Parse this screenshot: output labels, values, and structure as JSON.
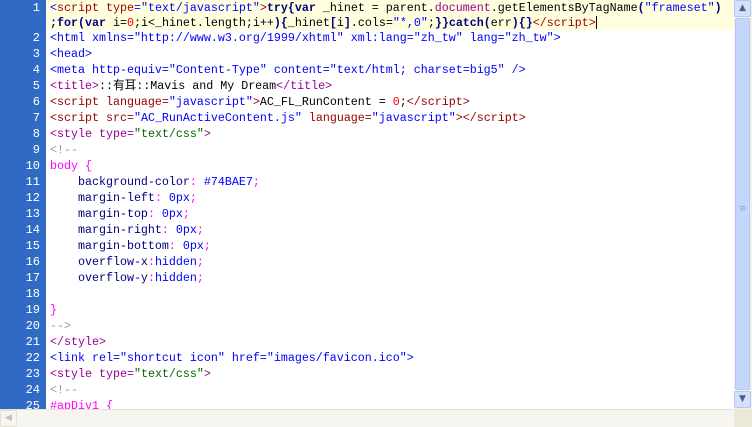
{
  "editor": {
    "lines": [
      {
        "num": "1",
        "rows": [
          [
            [
              "t",
              "<"
            ],
            [
              "s",
              "script "
            ],
            [
              "s",
              "type"
            ],
            [
              "t",
              "=\"text/javascript\""
            ],
            [
              "s",
              ">"
            ],
            [
              "b",
              "try{var"
            ],
            [
              "x",
              " _hinet = parent."
            ],
            [
              "d",
              "document"
            ],
            [
              "x",
              ".getElementsByTagName"
            ],
            [
              "b",
              "("
            ],
            [
              "t",
              "\"frameset\""
            ],
            [
              "b",
              ")"
            ]
          ],
          [
            [
              "b",
              ";for(var"
            ],
            [
              "x",
              " i="
            ],
            [
              "n",
              "0"
            ],
            [
              "x",
              ";i<_hinet.length;i++"
            ],
            [
              "b",
              ")"
            ],
            [
              "b",
              "{"
            ],
            [
              "x",
              "_hinet"
            ],
            [
              "b",
              "["
            ],
            [
              "x",
              "i"
            ],
            [
              "b",
              "]"
            ],
            [
              "x",
              ".cols="
            ],
            [
              "t",
              "\"*,0\""
            ],
            [
              "x",
              ";"
            ],
            [
              "b",
              "}}catch("
            ],
            [
              "x",
              "err"
            ],
            [
              "b",
              "){}"
            ],
            [
              "s",
              "</script>"
            ]
          ]
        ]
      },
      {
        "num": "2",
        "rows": [
          [
            [
              "t",
              "<html xmlns=\"http://www.w3.org/1999/xhtml\" xml:lang=\"zh_tw\" lang=\"zh_tw\">"
            ]
          ]
        ]
      },
      {
        "num": "3",
        "rows": [
          [
            [
              "t",
              "<head>"
            ]
          ]
        ]
      },
      {
        "num": "4",
        "rows": [
          [
            [
              "t",
              "<meta http-equiv=\"Content-Type\" content=\"text/html; charset=big5\" />"
            ]
          ]
        ]
      },
      {
        "num": "5",
        "rows": [
          [
            [
              "st",
              "<title>"
            ],
            [
              "x",
              "::有耳::Mavis and My Dream"
            ],
            [
              "st",
              "</title>"
            ]
          ]
        ]
      },
      {
        "num": "6",
        "rows": [
          [
            [
              "s",
              "<script language="
            ],
            [
              "t",
              "\"javascript\""
            ],
            [
              "s",
              ">"
            ],
            [
              "x",
              "AC_FL_RunContent = "
            ],
            [
              "n",
              "0"
            ],
            [
              "x",
              ";"
            ],
            [
              "s",
              "</script>"
            ]
          ]
        ]
      },
      {
        "num": "7",
        "rows": [
          [
            [
              "s",
              "<script src="
            ],
            [
              "t",
              "\"AC_RunActiveContent.js\""
            ],
            [
              "s",
              " language="
            ],
            [
              "t",
              "\"javascript\""
            ],
            [
              "s",
              "></script>"
            ]
          ]
        ]
      },
      {
        "num": "8",
        "rows": [
          [
            [
              "st",
              "<style type="
            ],
            [
              "g",
              "\"text/css\""
            ],
            [
              "st",
              ">"
            ]
          ]
        ]
      },
      {
        "num": "9",
        "rows": [
          [
            [
              "c",
              "<!--"
            ]
          ]
        ]
      },
      {
        "num": "10",
        "rows": [
          [
            [
              "m",
              "body {"
            ]
          ]
        ]
      },
      {
        "num": "11",
        "rows": [
          [
            [
              "p",
              "    background-color"
            ],
            [
              "m",
              ":"
            ],
            [
              "v",
              " #74BAE7"
            ],
            [
              "m",
              ";"
            ]
          ]
        ]
      },
      {
        "num": "12",
        "rows": [
          [
            [
              "p",
              "    margin-left"
            ],
            [
              "m",
              ":"
            ],
            [
              "v",
              " 0px"
            ],
            [
              "m",
              ";"
            ]
          ]
        ]
      },
      {
        "num": "13",
        "rows": [
          [
            [
              "p",
              "    margin-top"
            ],
            [
              "m",
              ":"
            ],
            [
              "v",
              " 0px"
            ],
            [
              "m",
              ";"
            ]
          ]
        ]
      },
      {
        "num": "14",
        "rows": [
          [
            [
              "p",
              "    margin-right"
            ],
            [
              "m",
              ":"
            ],
            [
              "v",
              " 0px"
            ],
            [
              "m",
              ";"
            ]
          ]
        ]
      },
      {
        "num": "15",
        "rows": [
          [
            [
              "p",
              "    margin-bottom"
            ],
            [
              "m",
              ":"
            ],
            [
              "v",
              " 0px"
            ],
            [
              "m",
              ";"
            ]
          ]
        ]
      },
      {
        "num": "16",
        "rows": [
          [
            [
              "p",
              "    overflow-x"
            ],
            [
              "m",
              ":"
            ],
            [
              "v",
              "hidden"
            ],
            [
              "m",
              ";"
            ]
          ]
        ]
      },
      {
        "num": "17",
        "rows": [
          [
            [
              "p",
              "    overflow-y"
            ],
            [
              "m",
              ":"
            ],
            [
              "v",
              "hidden"
            ],
            [
              "m",
              ";"
            ]
          ]
        ]
      },
      {
        "num": "18",
        "rows": [
          [
            [
              "x",
              ""
            ]
          ]
        ]
      },
      {
        "num": "19",
        "rows": [
          [
            [
              "m",
              "}"
            ]
          ]
        ]
      },
      {
        "num": "20",
        "rows": [
          [
            [
              "c",
              "-->"
            ]
          ]
        ]
      },
      {
        "num": "21",
        "rows": [
          [
            [
              "st",
              "</style>"
            ]
          ]
        ]
      },
      {
        "num": "22",
        "rows": [
          [
            [
              "t",
              "<link rel=\"shortcut icon\" href=\"images/favicon.ico\">"
            ]
          ]
        ]
      },
      {
        "num": "23",
        "rows": [
          [
            [
              "st",
              "<style type="
            ],
            [
              "g",
              "\"text/css\""
            ],
            [
              "st",
              ">"
            ]
          ]
        ]
      },
      {
        "num": "24",
        "rows": [
          [
            [
              "c",
              "<!--"
            ]
          ]
        ]
      },
      {
        "num": "25",
        "rows": [
          [
            [
              "m",
              "#apDiv1 {"
            ]
          ]
        ]
      }
    ]
  },
  "scrollbar": {
    "up_icon": "▲",
    "down_icon": "▼",
    "left_icon": "◀",
    "grip_icon": "≡"
  }
}
